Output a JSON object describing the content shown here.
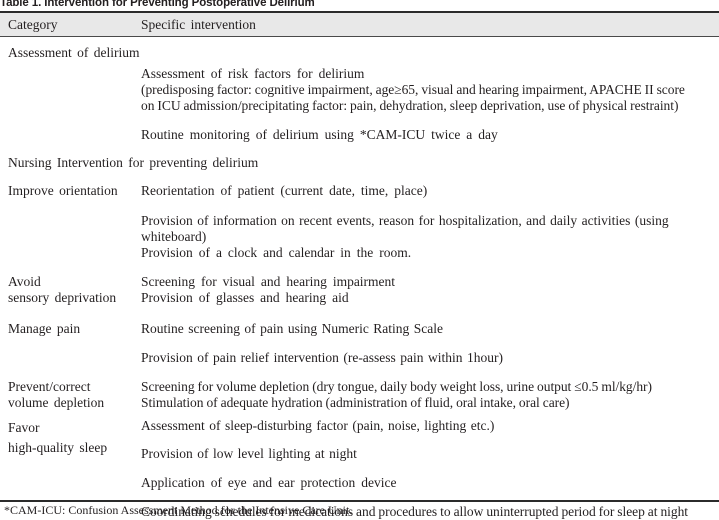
{
  "caption": "Table 1. Intervention for Preventing Postoperative Delirium",
  "header": {
    "col_category": "Category",
    "col_specific": "Specific  intervention"
  },
  "section_headings": {
    "assessment": "Assessment  of  delirium",
    "nursing": "Nursing  Intervention  for  preventing  delirium"
  },
  "rows": [
    {
      "category": "",
      "lines": [
        "Assessment  of  risk  factors  for  delirium",
        "(predisposing factor: cognitive impairment, age≥65, visual and hearing impairment, APACHE II score",
        "on ICU admission/precipitating factor: pain, dehydration, sleep deprivation, use of physical restraint)"
      ]
    },
    {
      "category": "",
      "lines": [
        "Routine  monitoring  of  delirium  using  *CAM-ICU  twice  a  day"
      ]
    },
    {
      "category": "Improve  orientation",
      "lines": [
        "Reorientation  of  patient (current  date,  time,  place)"
      ]
    },
    {
      "category": "",
      "lines": [
        "Provision of information on recent events, reason for hospitalization, and daily activities (using",
        "whiteboard)",
        "Provision  of  a  clock  and  calendar  in  the  room."
      ]
    },
    {
      "category": "Avoid\nsensory  deprivation",
      "lines": [
        "Screening  for  visual  and  hearing  impairment",
        "Provision  of  glasses  and  hearing  aid"
      ]
    },
    {
      "category": "Manage  pain",
      "lines": [
        "Routine  screening  of  pain  using  Numeric  Rating  Scale"
      ]
    },
    {
      "category": "",
      "lines": [
        "Provision  of  pain  relief  intervention (re-assess  pain  within  1hour)"
      ]
    },
    {
      "category": "Prevent/correct\nvolume  depletion",
      "lines": [
        "Screening for volume depletion (dry tongue, daily body weight loss, urine output ≤0.5 ml/kg/hr)",
        "Stimulation of adequate hydration (administration of fluid,  oral  intake,  oral  care)"
      ]
    },
    {
      "category": "Favor\nhigh-quality  sleep",
      "lines": [
        "Assessment  of  sleep-disturbing  factor (pain,  noise,  lighting  etc.)"
      ]
    },
    {
      "category": "",
      "lines": [
        "Provision  of  low  level  lighting  at  night"
      ]
    },
    {
      "category": "",
      "lines": [
        "Application  of  eye  and  ear  protection  device"
      ]
    },
    {
      "category": "",
      "lines": [
        "Coordinating schedules for medications and procedures to allow uninterrupted period for sleep at night"
      ]
    }
  ],
  "footnote": "*CAM-ICU: Confusion Assessment Method for the Intensive Care Unit.",
  "colors": {
    "header_background": "#e8e8e8",
    "rule": "#2b2b2b",
    "text": "#231f20"
  }
}
